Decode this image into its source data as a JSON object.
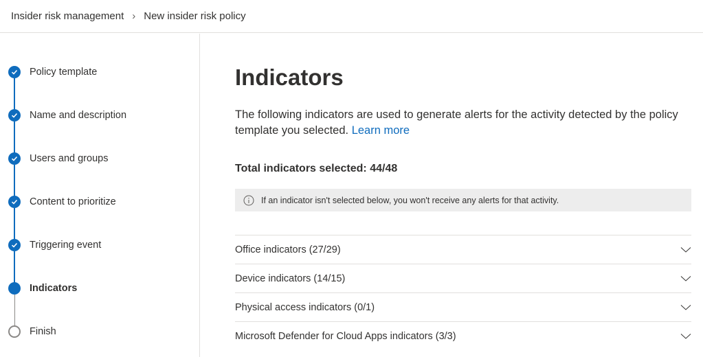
{
  "breadcrumb": {
    "root": "Insider risk management",
    "current": "New insider risk policy"
  },
  "steps": [
    {
      "label": "Policy template",
      "state": "done"
    },
    {
      "label": "Name and description",
      "state": "done"
    },
    {
      "label": "Users and groups",
      "state": "done"
    },
    {
      "label": "Content to prioritize",
      "state": "done"
    },
    {
      "label": "Triggering event",
      "state": "done"
    },
    {
      "label": "Indicators",
      "state": "current"
    },
    {
      "label": "Finish",
      "state": "todo"
    }
  ],
  "main": {
    "title": "Indicators",
    "description": "The following indicators are used to generate alerts for the activity detected by the policy template you selected.",
    "learn_more": "Learn more",
    "total": "Total indicators selected: 44/48",
    "info": "If an indicator isn't selected below, you won't receive any alerts for that activity.",
    "groups": [
      "Office indicators (27/29)",
      "Device indicators (14/15)",
      "Physical access indicators (0/1)",
      "Microsoft Defender for Cloud Apps indicators (3/3)"
    ]
  }
}
